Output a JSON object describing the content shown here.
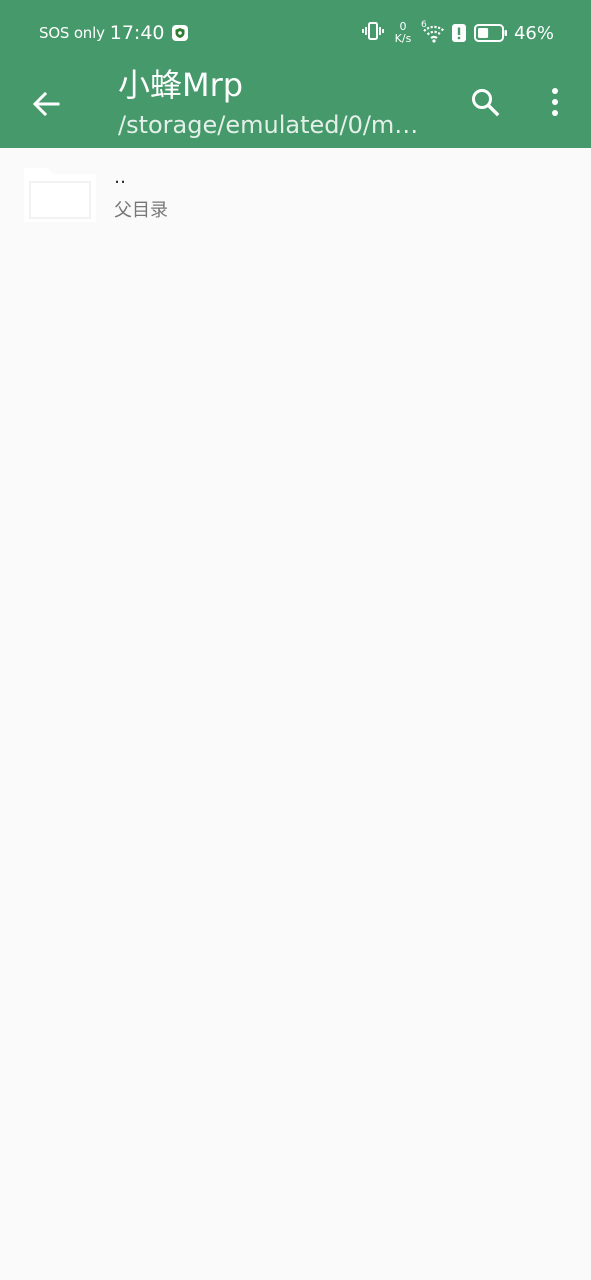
{
  "status_bar": {
    "carrier": "SOS only",
    "time": "17:40",
    "net_speed_value": "0",
    "net_speed_unit": "K/s",
    "wifi_label": "6",
    "battery_percent": "46%",
    "battery_level": 0.46,
    "icons": [
      "vpn-shield-icon",
      "vibrate-icon",
      "wifi-icon",
      "alert-icon",
      "battery-icon"
    ]
  },
  "toolbar": {
    "title": "小蜂Mrp",
    "subtitle": "/storage/emulated/0/m…",
    "icons": [
      "back-arrow-icon",
      "search-icon",
      "more-vert-icon"
    ]
  },
  "file_list": {
    "items": [
      {
        "name": "..",
        "description": "父目录",
        "icon": "folder-icon"
      }
    ]
  },
  "colors": {
    "primary": "#45996a",
    "background": "#fafafa",
    "on_primary": "#ffffff",
    "text_primary": "#333333",
    "text_secondary": "#777777"
  }
}
